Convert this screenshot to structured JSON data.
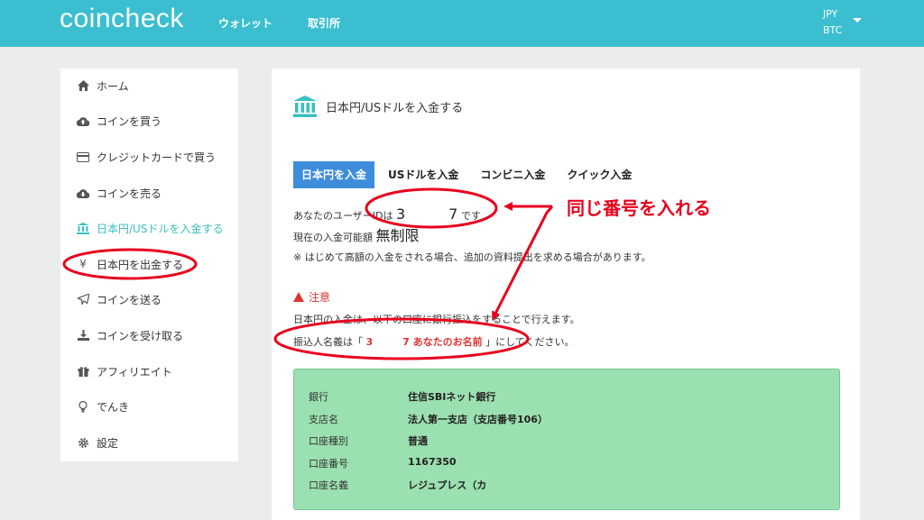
{
  "header": {
    "logo": "coincheck",
    "nav": [
      "ウォレット",
      "取引所"
    ],
    "currency_primary": "JPY",
    "currency_secondary": "BTC"
  },
  "sidebar": {
    "items": [
      {
        "label": "ホーム",
        "icon": "home-icon"
      },
      {
        "label": "コインを買う",
        "icon": "cloud-upload-icon"
      },
      {
        "label": "クレジットカードで買う",
        "icon": "credit-card-icon"
      },
      {
        "label": "コインを売る",
        "icon": "cloud-download-icon"
      },
      {
        "label": "日本円/USドルを入金する",
        "icon": "bank-icon",
        "active": true
      },
      {
        "label": "日本円を出金する",
        "icon": "yen-icon"
      },
      {
        "label": "コインを送る",
        "icon": "paper-plane-icon"
      },
      {
        "label": "コインを受け取る",
        "icon": "download-icon"
      },
      {
        "label": "アフィリエイト",
        "icon": "gift-icon"
      },
      {
        "label": "でんき",
        "icon": "lightbulb-icon"
      },
      {
        "label": "設定",
        "icon": "gear-icon"
      }
    ]
  },
  "main": {
    "title": "日本円/USドルを入金する",
    "tabs": [
      "日本円を入金",
      "USドルを入金",
      "コンビニ入金",
      "クイック入金"
    ],
    "user_id_prefix": "あなたのユーザーIDは",
    "user_id": "3　　　7",
    "user_id_suffix": "です",
    "limit_label": "現在の入金可能額",
    "limit_value": "無制限",
    "note": "※ はじめて高額の入金をされる場合、追加の資料提出を求める場合があります。",
    "warning_title": "注意",
    "warning_text": "日本円の入金は、以下の口座に銀行振込をすることで行えます。",
    "payer_prefix": "振込人名義は「",
    "payer_value": "3　　　7 あなたのお名前",
    "payer_suffix": "」にしてください。",
    "account": [
      {
        "key": "銀行",
        "value": "住信SBIネット銀行"
      },
      {
        "key": "支店名",
        "value": "法人第一支店（支店番号106）"
      },
      {
        "key": "口座種別",
        "value": "普通"
      },
      {
        "key": "口座番号",
        "value": "1167350"
      },
      {
        "key": "口座名義",
        "value": "レジュプレス（カ"
      }
    ]
  },
  "annotation": {
    "callout": "同じ番号を入れる",
    "color": "#e8001c"
  },
  "colors": {
    "header": "#3bbfd0",
    "active_tab": "#3e8ddb",
    "active_sidebar": "#3bbfc0",
    "account_box": "#9be0b0",
    "warning": "#dd3333"
  }
}
